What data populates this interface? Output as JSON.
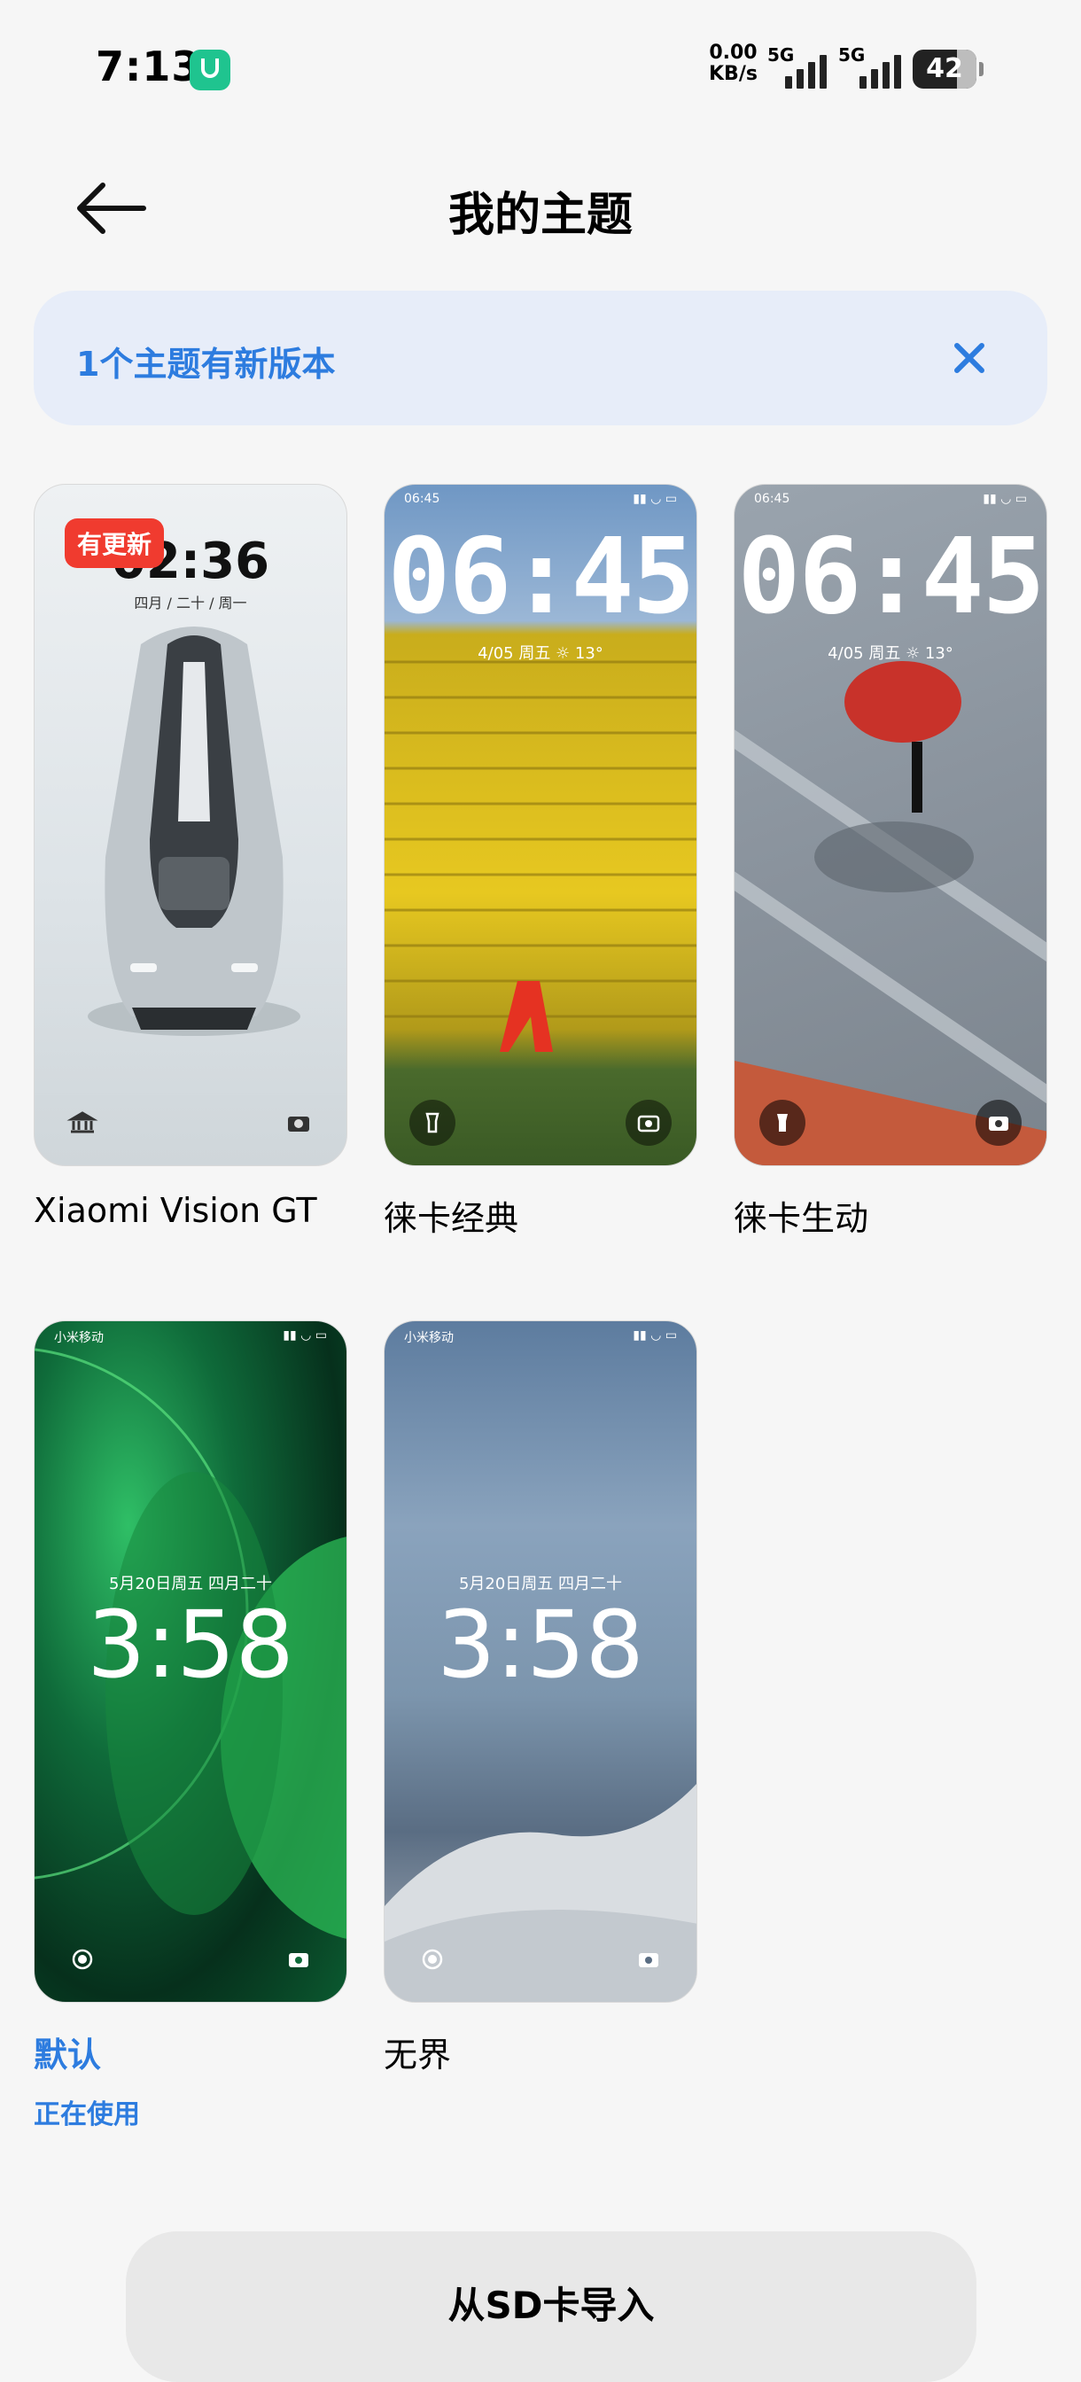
{
  "status_bar": {
    "time": "7:13",
    "net_speed_value": "0.00",
    "net_speed_unit": "KB/s",
    "sim1": "5G",
    "sim2": "5G",
    "battery": "42"
  },
  "header": {
    "title": "我的主题",
    "back_icon": "back-arrow-icon"
  },
  "banner": {
    "text": "1个主题有新版本",
    "close_icon": "close-icon"
  },
  "themes": [
    {
      "name": "Xiaomi Vision GT",
      "badge": "有更新",
      "time": "02:36",
      "date": "四月 / 二十 / 周一"
    },
    {
      "name": "徕卡经典",
      "time": "06:45",
      "date": "4/05 周五 ☼ 13°",
      "mini_time": "06:45"
    },
    {
      "name": "徕卡生动",
      "time": "06:45",
      "date": "4/05 周五 ☼ 13°",
      "mini_time": "06:45"
    },
    {
      "name": "默认",
      "status": "正在使用",
      "time": "3:58",
      "date": "5月20日周五 四月二十",
      "carrier": "小米移动"
    },
    {
      "name": "无界",
      "time": "3:58",
      "date": "5月20日周五 四月二十",
      "carrier": "小米移动"
    }
  ],
  "import_button": {
    "label": "从SD卡导入"
  },
  "colors": {
    "accent": "#2d7cdf",
    "badge": "#f03b2f",
    "banner_bg": "#e7edf9",
    "background": "#f6f6f6"
  }
}
